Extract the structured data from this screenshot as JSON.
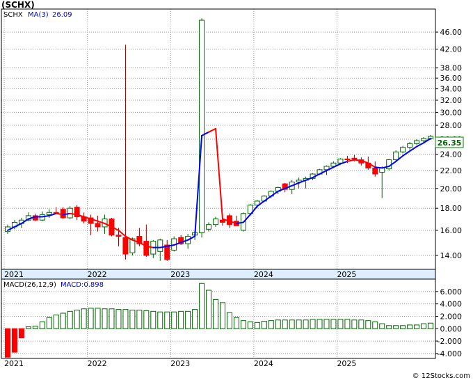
{
  "chart_data": [
    {
      "type": "candlestick",
      "title": "(SCHX)",
      "ma_label": "MA(3)",
      "ma_value": "26.09",
      "last_price": "26.35",
      "yscale": "log",
      "ylim": [
        13,
        52
      ],
      "y_ticks": [
        "14.00",
        "16.00",
        "18.00",
        "20.00",
        "22.00",
        "24.00",
        "26.00",
        "28.00",
        "30.00",
        "32.00",
        "34.00",
        "36.00",
        "38.00",
        "42.00",
        "46.00"
      ],
      "x_tick_labels": [
        "2021",
        "2022",
        "2023",
        "2024",
        "2025"
      ],
      "x_ticks": [
        "2021",
        "2022",
        "2023",
        "2024",
        "2025"
      ],
      "grid": true,
      "colors": {
        "up": "#006400",
        "down": "#ff0000",
        "ma_up": "#0000ff",
        "ma_down": "#ff0000",
        "macd_bar": "#006400",
        "macd_neg": "#ff0000"
      },
      "candles": [
        [
          "2021-01",
          15.9,
          16.5,
          15.7,
          16.3
        ],
        [
          "2021-02",
          16.3,
          16.9,
          16.1,
          16.7
        ],
        [
          "2021-03",
          16.6,
          17.1,
          16.2,
          16.9
        ],
        [
          "2021-04",
          16.9,
          17.6,
          16.8,
          17.3
        ],
        [
          "2021-05",
          17.3,
          17.5,
          16.8,
          16.9
        ],
        [
          "2021-06",
          16.9,
          17.7,
          16.8,
          17.4
        ],
        [
          "2021-07",
          17.4,
          17.9,
          17.1,
          17.6
        ],
        [
          "2021-08",
          17.6,
          18.1,
          17.5,
          17.5
        ],
        [
          "2021-09",
          17.9,
          18.1,
          17.0,
          17.1
        ],
        [
          "2021-10",
          17.1,
          18.2,
          17.0,
          18.0
        ],
        [
          "2021-11",
          18.1,
          18.3,
          16.9,
          17.2
        ],
        [
          "2021-12",
          17.2,
          17.6,
          16.6,
          16.8
        ],
        [
          "2022-01",
          17.1,
          17.4,
          15.6,
          16.6
        ],
        [
          "2022-02",
          16.6,
          17.3,
          15.9,
          16.3
        ],
        [
          "2022-03",
          16.3,
          17.4,
          15.7,
          17.0
        ],
        [
          "2022-04",
          17.0,
          17.1,
          15.5,
          15.6
        ],
        [
          "2022-05",
          15.6,
          16.2,
          14.7,
          15.5
        ],
        [
          "2022-06",
          15.4,
          43.0,
          13.7,
          14.1
        ],
        [
          "2022-07",
          14.2,
          15.4,
          14.0,
          15.3
        ],
        [
          "2022-08",
          15.5,
          16.2,
          14.7,
          14.9
        ],
        [
          "2022-09",
          15.1,
          16.5,
          13.9,
          14.0
        ],
        [
          "2022-10",
          14.1,
          15.2,
          13.8,
          15.1
        ],
        [
          "2022-11",
          14.3,
          15.3,
          13.6,
          15.2
        ],
        [
          "2022-12",
          14.8,
          15.2,
          13.6,
          13.7
        ],
        [
          "2023-01",
          14.4,
          15.5,
          14.3,
          15.3
        ],
        [
          "2023-02",
          15.4,
          15.6,
          14.8,
          14.9
        ],
        [
          "2023-03",
          14.9,
          15.7,
          14.5,
          15.5
        ],
        [
          "2023-04",
          15.6,
          16.0,
          15.2,
          15.8
        ],
        [
          "2023-05",
          15.8,
          49.5,
          15.4,
          49.0
        ],
        [
          "2023-06",
          16.1,
          16.7,
          15.9,
          16.5
        ],
        [
          "2023-07",
          16.5,
          17.2,
          16.3,
          17.0
        ],
        [
          "2023-08",
          16.9,
          17.0,
          16.4,
          16.7
        ],
        [
          "2023-09",
          17.3,
          17.5,
          16.2,
          16.5
        ],
        [
          "2023-10",
          16.8,
          17.3,
          16.4,
          16.4
        ],
        [
          "2023-11",
          16.0,
          17.6,
          15.9,
          17.5
        ],
        [
          "2023-12",
          17.5,
          18.4,
          17.4,
          18.3
        ],
        [
          "2024-01",
          18.3,
          18.8,
          18.0,
          18.7
        ],
        [
          "2024-02",
          18.7,
          19.3,
          18.6,
          19.2
        ],
        [
          "2024-03",
          19.2,
          19.8,
          19.0,
          19.7
        ],
        [
          "2024-04",
          19.7,
          20.2,
          19.4,
          20.1
        ],
        [
          "2024-05",
          20.5,
          20.6,
          19.6,
          19.9
        ],
        [
          "2024-06",
          19.9,
          20.9,
          19.4,
          20.7
        ],
        [
          "2024-07",
          20.7,
          21.2,
          20.0,
          20.9
        ],
        [
          "2024-08",
          20.9,
          21.3,
          20.0,
          21.1
        ],
        [
          "2024-09",
          21.1,
          21.7,
          20.9,
          21.6
        ],
        [
          "2024-10",
          21.6,
          22.2,
          21.5,
          22.1
        ],
        [
          "2024-11",
          22.1,
          22.6,
          21.5,
          22.5
        ],
        [
          "2024-12",
          22.5,
          23.1,
          22.3,
          22.9
        ],
        [
          "2025-01",
          22.9,
          23.5,
          22.7,
          23.4
        ],
        [
          "2025-02",
          23.4,
          23.8,
          22.9,
          23.3
        ],
        [
          "2025-03",
          23.5,
          23.9,
          23.1,
          23.4
        ],
        [
          "2025-04",
          23.3,
          23.6,
          22.6,
          22.9
        ],
        [
          "2025-05",
          22.9,
          23.7,
          22.1,
          22.3
        ],
        [
          "2025-06",
          22.3,
          23.1,
          21.3,
          21.6
        ],
        [
          "2025-07",
          21.8,
          22.5,
          19.0,
          22.3
        ],
        [
          "2025-08",
          22.2,
          23.4,
          22.0,
          23.3
        ],
        [
          "2025-09",
          23.3,
          24.5,
          23.2,
          24.3
        ],
        [
          "2025-10",
          24.3,
          25.1,
          24.1,
          24.9
        ],
        [
          "2025-11",
          24.9,
          25.6,
          24.6,
          25.4
        ],
        [
          "2025-12",
          25.4,
          26.0,
          25.2,
          25.8
        ],
        [
          "2026-01",
          25.8,
          26.3,
          25.6,
          26.1
        ],
        [
          "2026-02",
          26.1,
          26.6,
          25.9,
          26.4
        ]
      ],
      "ma": [
        16.0,
        16.3,
        16.6,
        17.0,
        17.2,
        17.2,
        17.3,
        17.5,
        17.4,
        17.5,
        17.4,
        17.2,
        17.0,
        16.8,
        16.6,
        16.3,
        16.0,
        15.5,
        15.2,
        15.0,
        14.7,
        14.6,
        14.6,
        14.7,
        14.8,
        15.0,
        15.2,
        15.5,
        26.5,
        27.0,
        27.5,
        17.0,
        16.8,
        16.6,
        16.7,
        17.4,
        18.2,
        18.7,
        19.2,
        19.7,
        20.0,
        20.3,
        20.6,
        20.9,
        21.2,
        21.6,
        22.0,
        22.4,
        22.8,
        23.1,
        23.3,
        23.2,
        22.9,
        22.4,
        22.3,
        22.5,
        23.1,
        23.8,
        24.4,
        25.0,
        25.5,
        26.09
      ],
      "ma_colors": [
        "u",
        "u",
        "u",
        "u",
        "u",
        "u",
        "u",
        "u",
        "d",
        "u",
        "d",
        "d",
        "d",
        "d",
        "d",
        "d",
        "d",
        "d",
        "d",
        "d",
        "d",
        "d",
        "u",
        "u",
        "u",
        "u",
        "u",
        "u",
        "u",
        "u",
        "d",
        "d",
        "d",
        "d",
        "u",
        "u",
        "u",
        "u",
        "u",
        "u",
        "u",
        "u",
        "u",
        "u",
        "u",
        "u",
        "u",
        "u",
        "u",
        "u",
        "d",
        "d",
        "d",
        "d",
        "u",
        "u",
        "u",
        "u",
        "u",
        "u",
        "u",
        "u"
      ]
    },
    {
      "type": "bar",
      "title": "MACD(26,12,9)",
      "macd_label": "MACD:0.898",
      "ylim": [
        -4.8,
        8.0
      ],
      "y_ticks": [
        "-4.000",
        "-2.000",
        "0.000",
        "2.000",
        "4.000",
        "6.000"
      ],
      "x_tick_labels": [
        "2021",
        "2022",
        "2023",
        "2024",
        "2025"
      ],
      "x_ticks": [
        "2021",
        "2022",
        "2023",
        "2024",
        "2025"
      ],
      "values": [
        -4.6,
        -3.8,
        -1.5,
        0.3,
        0.4,
        1.1,
        1.8,
        2.2,
        2.5,
        2.8,
        3.0,
        3.2,
        3.3,
        3.3,
        3.2,
        3.2,
        3.1,
        3.1,
        3.0,
        3.0,
        2.9,
        2.8,
        2.7,
        2.7,
        2.7,
        2.8,
        2.8,
        3.1,
        7.3,
        6.2,
        4.7,
        4.2,
        2.6,
        1.8,
        1.3,
        1.1,
        1.0,
        1.2,
        1.3,
        1.4,
        1.4,
        1.4,
        1.4,
        1.4,
        1.5,
        1.5,
        1.5,
        1.5,
        1.5,
        1.5,
        1.4,
        1.4,
        1.3,
        1.1,
        0.8,
        0.5,
        0.5,
        0.5,
        0.6,
        0.6,
        0.8,
        0.898
      ]
    }
  ],
  "watermark": "© 12Stocks.com"
}
